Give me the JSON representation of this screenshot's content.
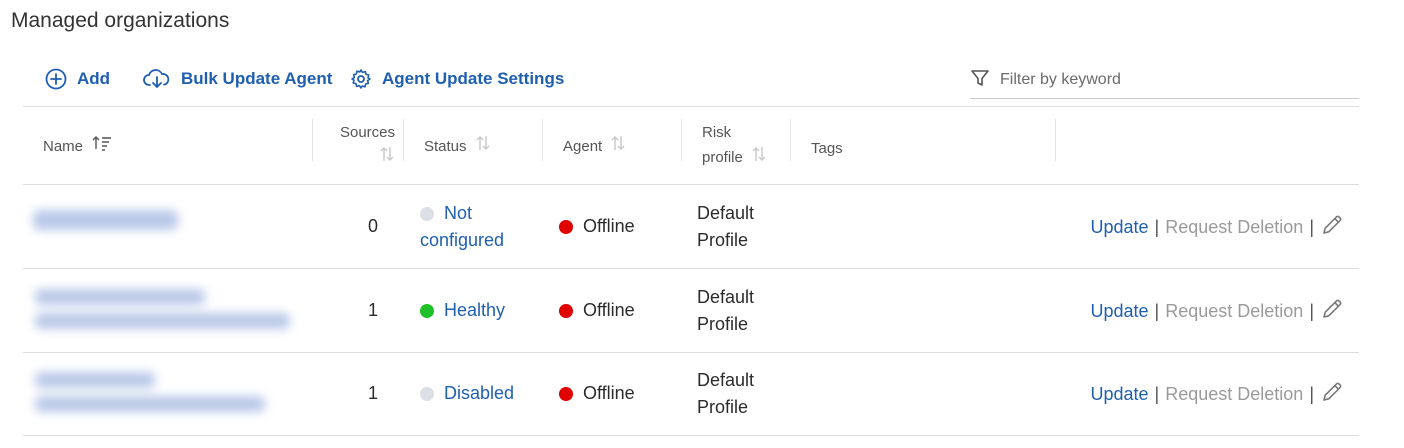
{
  "page": {
    "title": "Managed organizations"
  },
  "toolbar": {
    "add_label": "Add",
    "bulk_update_label": "Bulk Update Agent",
    "agent_update_settings_label": "Agent Update Settings",
    "filter_placeholder": "Filter by keyword",
    "filter_value": ""
  },
  "table": {
    "headers": {
      "name": "Name",
      "sources": "Sources",
      "status": "Status",
      "agent": "Agent",
      "risk_profile_line1": "Risk",
      "risk_profile_line2": "profile",
      "tags": "Tags"
    },
    "rows": [
      {
        "name": "",
        "sources": "0",
        "status_line1": "Not",
        "status_line2": "configured",
        "status_color": "#dcdfe6",
        "agent": "Offline",
        "agent_color": "#e00000",
        "risk_line1": "Default",
        "risk_line2": "Profile",
        "tags": ""
      },
      {
        "name": "",
        "sources": "1",
        "status_line1": "Healthy",
        "status_line2": "",
        "status_color": "#1fc02a",
        "agent": "Offline",
        "agent_color": "#e00000",
        "risk_line1": "Default",
        "risk_line2": "Profile",
        "tags": ""
      },
      {
        "name": "",
        "sources": "1",
        "status_line1": "Disabled",
        "status_line2": "",
        "status_color": "#dcdfe6",
        "agent": "Offline",
        "agent_color": "#e00000",
        "risk_line1": "Default",
        "risk_line2": "Profile",
        "tags": ""
      }
    ],
    "actions": {
      "update": "Update",
      "request_deletion": "Request Deletion",
      "separator": "|"
    }
  },
  "icons": {
    "add": "plus-circle-icon",
    "bulk_update": "cloud-download-icon",
    "settings": "gear-icon",
    "filter": "filter-icon",
    "sort": "sort-icon",
    "edit": "pencil-icon"
  },
  "colors": {
    "accent": "#1f5fb0",
    "offline": "#e00000",
    "healthy": "#1fc02a",
    "inactive": "#dcdfe6"
  }
}
